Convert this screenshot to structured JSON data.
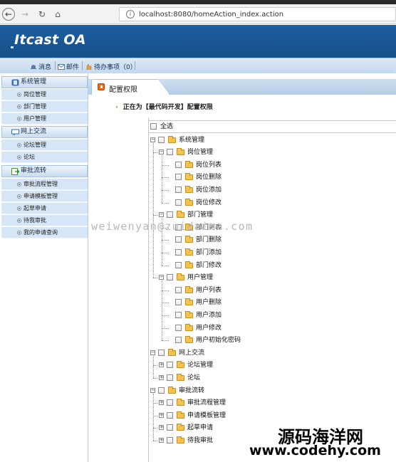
{
  "browser": {
    "url": "localhost:8080/homeAction_index.action"
  },
  "app": {
    "title": "Itcast OA",
    "toolbar": [
      {
        "label": "消息",
        "icon": "bell-icon"
      },
      {
        "label": "邮件",
        "icon": "mail-icon"
      },
      {
        "label": "待办事项（0）",
        "icon": "hand-icon"
      }
    ]
  },
  "sidebar": {
    "groups": [
      {
        "label": "系统管理",
        "icon": "system-icon",
        "items": [
          "岗位管理",
          "部门管理",
          "用户管理"
        ]
      },
      {
        "label": "网上交流",
        "icon": "chat-icon",
        "items": [
          "论坛管理",
          "论坛"
        ]
      },
      {
        "label": "审批流转",
        "icon": "approval-icon",
        "items": [
          "审批流程管理",
          "申请模板管理",
          "起草申请",
          "待我审批",
          "我的申请查询"
        ]
      }
    ]
  },
  "main": {
    "tab_title": "配置权限",
    "breadcrumb": "正在为【最代码开发】配置权限",
    "select_all": "全选",
    "tree": [
      {
        "label": "系统管理",
        "expanded": true,
        "children": [
          {
            "label": "岗位管理",
            "expanded": true,
            "children": [
              "岗位列表",
              "岗位删除",
              "岗位添加",
              "岗位修改"
            ]
          },
          {
            "label": "部门管理",
            "expanded": true,
            "children": [
              "部门列表",
              "部门删除",
              "部门添加",
              "部门修改"
            ]
          },
          {
            "label": "用户管理",
            "expanded": true,
            "children": [
              "用户列表",
              "用户删除",
              "用户添加",
              "用户修改",
              "用户初始化密码"
            ]
          }
        ]
      },
      {
        "label": "网上交流",
        "expanded": true,
        "children": [
          {
            "label": "论坛管理",
            "expanded": false,
            "children": []
          },
          {
            "label": "论坛",
            "expanded": false,
            "children": []
          }
        ]
      },
      {
        "label": "审批流转",
        "expanded": true,
        "children": [
          {
            "label": "审批流程管理",
            "expanded": false,
            "children": []
          },
          {
            "label": "申请模板管理",
            "expanded": false,
            "children": []
          },
          {
            "label": "起草申请",
            "expanded": false,
            "children": []
          },
          {
            "label": "待我审批",
            "expanded": false,
            "children": []
          }
        ]
      }
    ]
  },
  "watermark": "weiwenyan@zuidaima.com",
  "brand": {
    "line1": "源码海洋网",
    "line2": "www.codehy.com"
  }
}
